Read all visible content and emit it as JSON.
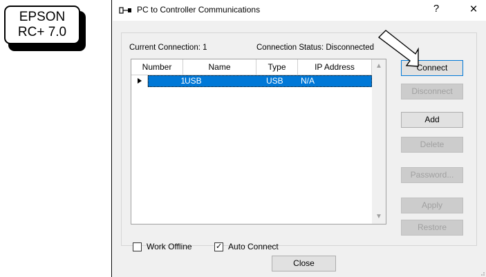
{
  "badge": {
    "line1": "EPSON",
    "line2": "RC+ 7.0"
  },
  "window": {
    "title": "PC to Controller Communications",
    "help_label": "?",
    "close_label": "×",
    "icon": "connector-icon"
  },
  "status": {
    "current_connection": "Current Connection: 1",
    "connection_status": "Connection Status: Disconnected"
  },
  "grid": {
    "columns": [
      "Number",
      "Name",
      "Type",
      "IP Address"
    ],
    "rows": [
      {
        "number": "1",
        "name": "USB",
        "type": "USB",
        "ip": "N/A"
      }
    ],
    "scroll_up": "▲",
    "scroll_down": "▼"
  },
  "options": {
    "work_offline": {
      "label": "Work Offline",
      "checked": false
    },
    "auto_connect": {
      "label": "Auto Connect",
      "checked": true,
      "mark": "✓"
    }
  },
  "buttons": {
    "connect": "Connect",
    "disconnect": "Disconnect",
    "add": "Add",
    "delete": "Delete",
    "password": "Password...",
    "apply": "Apply",
    "restore": "Restore",
    "close": "Close"
  },
  "colors": {
    "selection": "#0078d7",
    "dialog_bg": "#f0f0f0",
    "disabled_text": "#a0a0a0"
  }
}
